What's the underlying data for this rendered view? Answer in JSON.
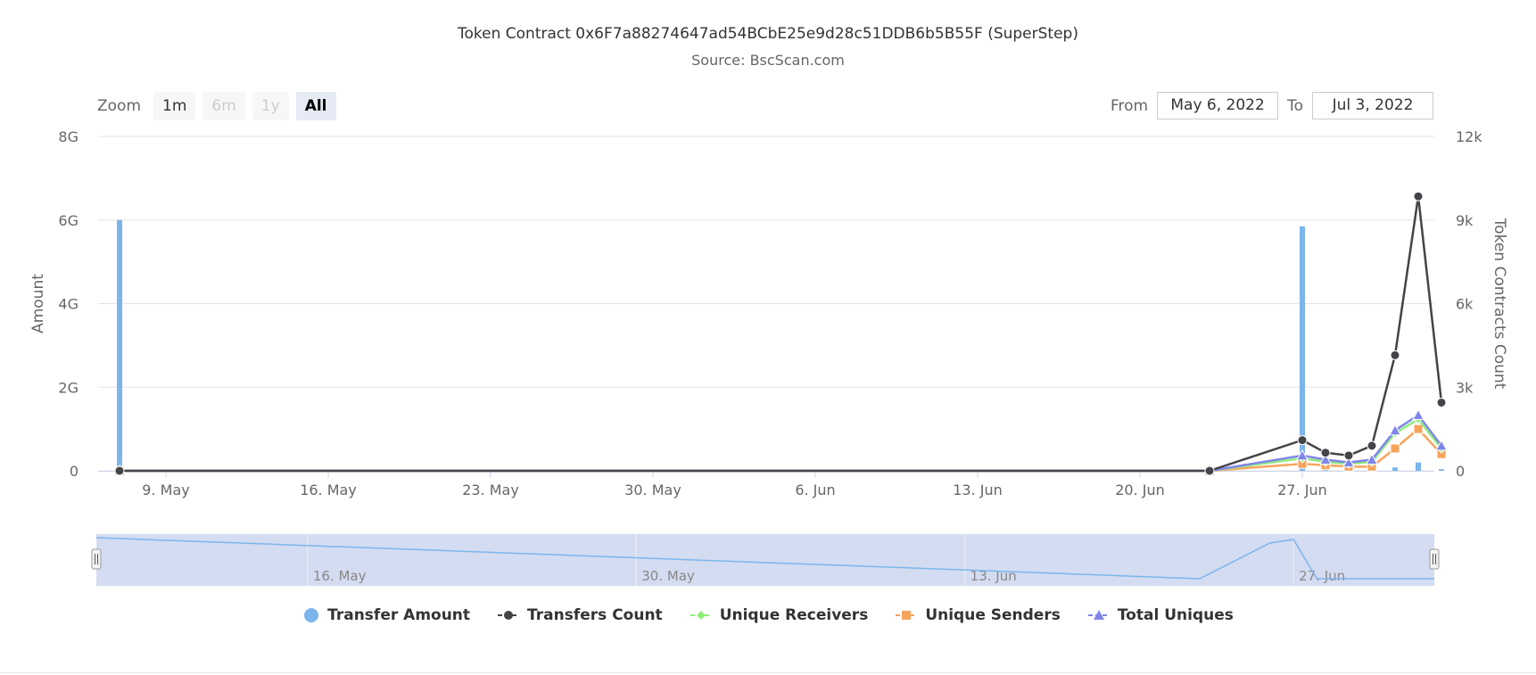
{
  "title": "Token Contract 0x6F7a88274647ad54BCbE25e9d28c51DDB6b5B55F (SuperStep)",
  "subtitle": "Source: BscScan.com",
  "zoom": {
    "label": "Zoom",
    "buttons": [
      {
        "label": "1m",
        "state": "normal"
      },
      {
        "label": "6m",
        "state": "disabled"
      },
      {
        "label": "1y",
        "state": "disabled"
      },
      {
        "label": "All",
        "state": "active"
      }
    ]
  },
  "range": {
    "from_label": "From",
    "from_value": "May 6, 2022",
    "to_label": "To",
    "to_value": "Jul 3, 2022"
  },
  "colors": {
    "transfer_amount": "#7cb5ec",
    "transfers_count": "#434348",
    "unique_receivers": "#90ed7d",
    "unique_senders": "#f7a35c",
    "total_uniques": "#8085e9",
    "navigator_fill": "#cdd6ee",
    "grid": "#e6e6e6"
  },
  "chart_data": {
    "type": "line",
    "x_axis": {
      "type": "datetime",
      "range": [
        "2022-05-07",
        "2022-07-03"
      ],
      "tick_labels": [
        {
          "date": "2022-05-09",
          "label": "9. May"
        },
        {
          "date": "2022-05-16",
          "label": "16. May"
        },
        {
          "date": "2022-05-23",
          "label": "23. May"
        },
        {
          "date": "2022-05-30",
          "label": "30. May"
        },
        {
          "date": "2022-06-06",
          "label": "6. Jun"
        },
        {
          "date": "2022-06-13",
          "label": "13. Jun"
        },
        {
          "date": "2022-06-20",
          "label": "20. Jun"
        },
        {
          "date": "2022-06-27",
          "label": "27. Jun"
        }
      ]
    },
    "y_axes": [
      {
        "label": "Amount",
        "range": [
          0,
          8000000000
        ],
        "tick_labels": [
          "0",
          "2G",
          "4G",
          "6G",
          "8G"
        ],
        "tick_values": [
          0,
          2000000000,
          4000000000,
          6000000000,
          8000000000
        ]
      },
      {
        "label": "Token Contracts Count",
        "range": [
          0,
          12000
        ],
        "tick_labels": [
          "0",
          "3k",
          "6k",
          "9k",
          "12k"
        ],
        "tick_values": [
          0,
          3000,
          6000,
          9000,
          12000
        ]
      }
    ],
    "series": [
      {
        "name": "Transfer Amount",
        "type": "column",
        "axis": 0,
        "points": [
          {
            "x": "2022-05-07",
            "y": 6000000000
          },
          {
            "x": "2022-06-27",
            "y": 5850000000
          },
          {
            "x": "2022-06-28",
            "y": 40000000
          },
          {
            "x": "2022-06-29",
            "y": 30000000
          },
          {
            "x": "2022-06-30",
            "y": 30000000
          },
          {
            "x": "2022-07-01",
            "y": 80000000
          },
          {
            "x": "2022-07-02",
            "y": 200000000
          },
          {
            "x": "2022-07-03",
            "y": 40000000
          }
        ]
      },
      {
        "name": "Transfers Count",
        "type": "line",
        "axis": 1,
        "points": [
          {
            "x": "2022-05-07",
            "y": 0
          },
          {
            "x": "2022-06-23",
            "y": 0
          },
          {
            "x": "2022-06-27",
            "y": 1100
          },
          {
            "x": "2022-06-28",
            "y": 650
          },
          {
            "x": "2022-06-29",
            "y": 550
          },
          {
            "x": "2022-06-30",
            "y": 900
          },
          {
            "x": "2022-07-01",
            "y": 4150
          },
          {
            "x": "2022-07-02",
            "y": 9850
          },
          {
            "x": "2022-07-03",
            "y": 2450
          }
        ]
      },
      {
        "name": "Unique Receivers",
        "type": "line",
        "axis": 1,
        "points": [
          {
            "x": "2022-05-07",
            "y": 0
          },
          {
            "x": "2022-06-23",
            "y": 0
          },
          {
            "x": "2022-06-27",
            "y": 450
          },
          {
            "x": "2022-06-28",
            "y": 320
          },
          {
            "x": "2022-06-29",
            "y": 250
          },
          {
            "x": "2022-06-30",
            "y": 320
          },
          {
            "x": "2022-07-01",
            "y": 1350
          },
          {
            "x": "2022-07-02",
            "y": 1850
          },
          {
            "x": "2022-07-03",
            "y": 800
          }
        ]
      },
      {
        "name": "Unique Senders",
        "type": "line",
        "axis": 1,
        "points": [
          {
            "x": "2022-05-07",
            "y": 0
          },
          {
            "x": "2022-06-23",
            "y": 0
          },
          {
            "x": "2022-06-27",
            "y": 250
          },
          {
            "x": "2022-06-28",
            "y": 200
          },
          {
            "x": "2022-06-29",
            "y": 150
          },
          {
            "x": "2022-06-30",
            "y": 150
          },
          {
            "x": "2022-07-01",
            "y": 800
          },
          {
            "x": "2022-07-02",
            "y": 1500
          },
          {
            "x": "2022-07-03",
            "y": 600
          }
        ]
      },
      {
        "name": "Total Uniques",
        "type": "line",
        "axis": 1,
        "points": [
          {
            "x": "2022-05-07",
            "y": 0
          },
          {
            "x": "2022-06-23",
            "y": 0
          },
          {
            "x": "2022-06-27",
            "y": 550
          },
          {
            "x": "2022-06-28",
            "y": 400
          },
          {
            "x": "2022-06-29",
            "y": 300
          },
          {
            "x": "2022-06-30",
            "y": 400
          },
          {
            "x": "2022-07-01",
            "y": 1450
          },
          {
            "x": "2022-07-02",
            "y": 2000
          },
          {
            "x": "2022-07-03",
            "y": 900
          }
        ]
      }
    ],
    "navigator": {
      "tick_labels": [
        {
          "date": "2022-05-16",
          "label": "16. May"
        },
        {
          "date": "2022-05-30",
          "label": "30. May"
        },
        {
          "date": "2022-06-13",
          "label": "13. Jun"
        },
        {
          "date": "2022-06-27",
          "label": "27. Jun"
        }
      ]
    },
    "legend": {
      "placement": "bottom",
      "items": [
        "Transfer Amount",
        "Transfers Count",
        "Unique Receivers",
        "Unique Senders",
        "Total Uniques"
      ]
    },
    "grid": true
  }
}
